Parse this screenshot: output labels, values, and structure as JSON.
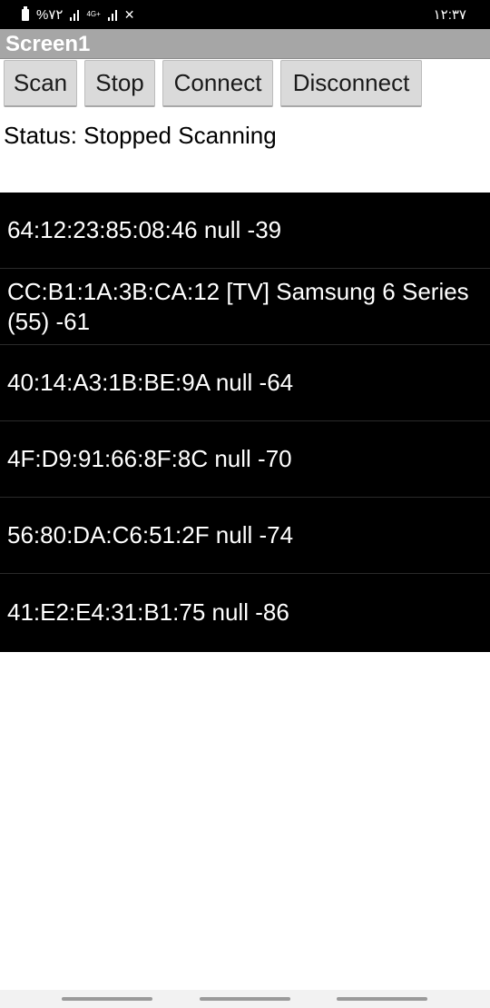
{
  "status_bar": {
    "battery_text": "%۷۲",
    "network_label": "4G+",
    "time": "۱۲:۳۷"
  },
  "app": {
    "title": "Screen1"
  },
  "buttons": {
    "scan": "Scan",
    "stop": "Stop",
    "connect": "Connect",
    "disconnect": "Disconnect"
  },
  "status_text": "Status: Stopped Scanning",
  "devices": [
    "64:12:23:85:08:46 null -39",
    "CC:B1:1A:3B:CA:12 [TV] Samsung 6 Series (55) -61",
    "40:14:A3:1B:BE:9A null -64",
    "4F:D9:91:66:8F:8C null -70",
    "56:80:DA:C6:51:2F null -74",
    "41:E2:E4:31:B1:75 null -86"
  ],
  "icons": {
    "battery": "battery-icon",
    "signal": "signal-icon",
    "mute": "mute-icon"
  },
  "colors": {
    "title_bar": "#a6a6a6",
    "list_background": "#000000",
    "button_background": "#dadada"
  }
}
